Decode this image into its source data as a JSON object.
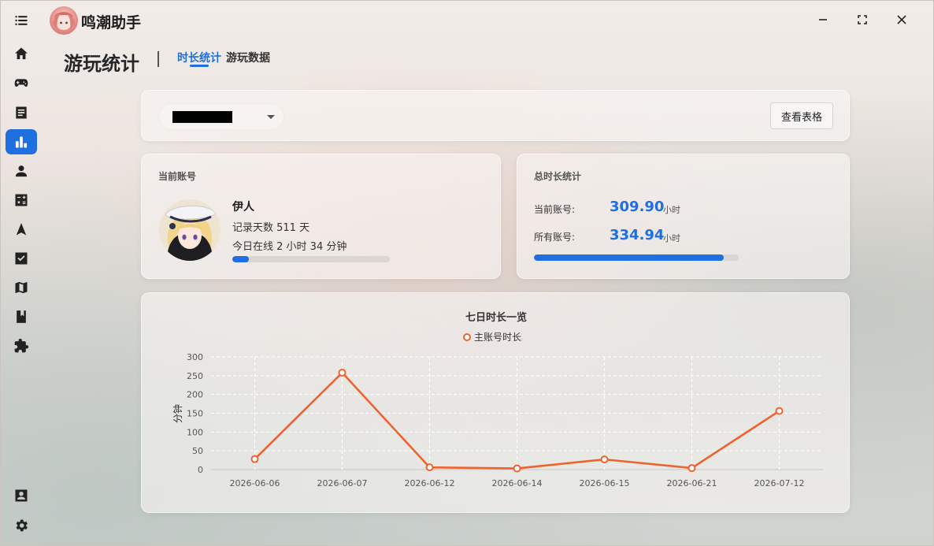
{
  "app": {
    "title": "鸣潮助手"
  },
  "sidebar": {
    "items": [
      {
        "name": "menu-icon"
      },
      {
        "name": "home-icon"
      },
      {
        "name": "gamepad-icon"
      },
      {
        "name": "document-icon"
      },
      {
        "name": "bar-chart-icon"
      },
      {
        "name": "person-icon"
      },
      {
        "name": "calculator-icon"
      },
      {
        "name": "navigation-icon"
      },
      {
        "name": "checkbox-icon"
      },
      {
        "name": "map-icon"
      },
      {
        "name": "book-icon"
      },
      {
        "name": "puzzle-icon"
      },
      {
        "name": "account-box-icon"
      },
      {
        "name": "settings-icon"
      }
    ],
    "active": "bar-chart-icon"
  },
  "header": {
    "title": "游玩统计",
    "tabs": [
      {
        "label": "时长统计",
        "active": true
      },
      {
        "label": "游玩数据",
        "active": false
      }
    ]
  },
  "toolbar": {
    "account_select_value": "████████",
    "view_table_label": "查看表格"
  },
  "current_account": {
    "title": "当前账号",
    "name": "伊人",
    "record_days": "记录天数 511 天",
    "online_today": "今日在线 2 小时 34 分钟",
    "today_progress": 0.107
  },
  "total_stats": {
    "title": "总时长统计",
    "current_label": "当前账号:",
    "current_value": "309.90",
    "current_unit": "小时",
    "all_label": "所有账号:",
    "all_value": "334.94",
    "all_unit": "小时",
    "progress": 0.925
  },
  "colors": {
    "accent": "#1f6fe0",
    "series": "#ee6430"
  },
  "chart_data": {
    "type": "line",
    "title": "七日时长一览",
    "ylabel": "分钟",
    "xlabel": "",
    "categories": [
      "2026-06-06",
      "2026-06-07",
      "2026-06-12",
      "2026-06-14",
      "2026-06-15",
      "2026-06-21",
      "2026-07-12"
    ],
    "series": [
      {
        "name": "主账号时长",
        "values": [
          28,
          258,
          6,
          3,
          27,
          4,
          156
        ]
      }
    ],
    "ylim": [
      0,
      300
    ],
    "yticks": [
      0,
      50,
      100,
      150,
      200,
      250,
      300
    ],
    "grid": true,
    "legend": "top-center"
  }
}
